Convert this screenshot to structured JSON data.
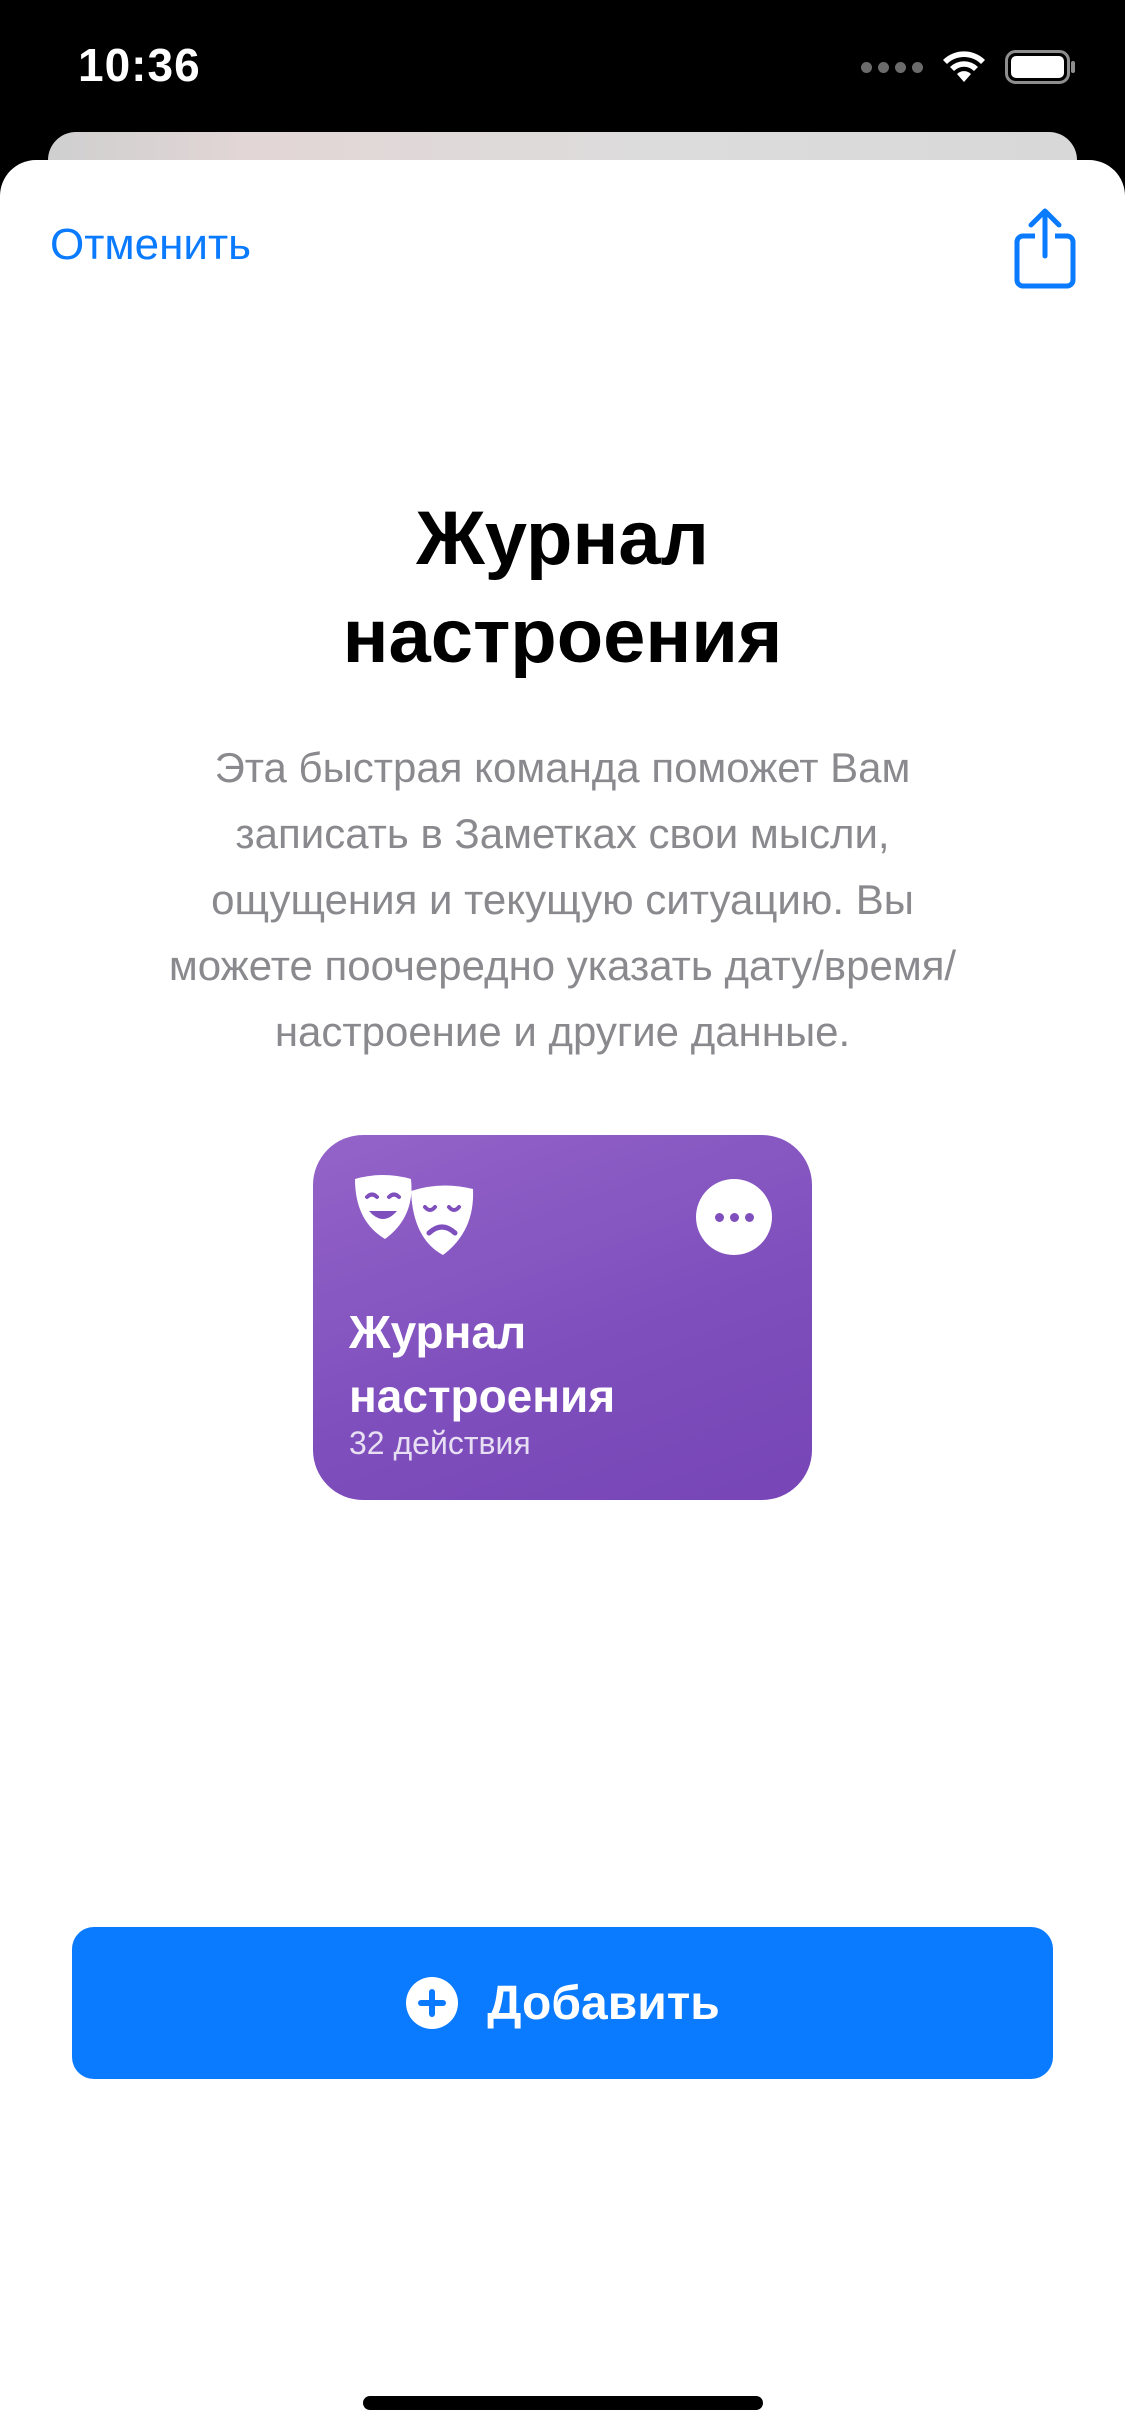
{
  "status_bar": {
    "time": "10:36",
    "icons": [
      "cellular-signal-icon",
      "wifi-icon",
      "battery-icon"
    ]
  },
  "sheet": {
    "cancel_label": "Отменить",
    "share_icon": "share-icon",
    "title_line1": "Журнал",
    "title_line2": "настроения",
    "description_lines": [
      "Эта быстрая команда поможет Вам",
      "записать в Заметках свои мысли,",
      "ощущения и текущую ситуацию. Вы",
      "можете поочередно указать дату/время/",
      "настроение и другие данные."
    ]
  },
  "shortcut_tile": {
    "icon": "theater-masks-icon",
    "more_icon": "more-icon",
    "name_line1": "Журнал",
    "name_line2": "настроения",
    "actions_count": "32 действия",
    "color": "#8054bf"
  },
  "add_button": {
    "label": "Добавить",
    "icon": "plus-circle-icon",
    "color": "#0a7aff"
  },
  "colors": {
    "accent": "#0a7aff",
    "secondary_text": "#8a8a8e"
  }
}
